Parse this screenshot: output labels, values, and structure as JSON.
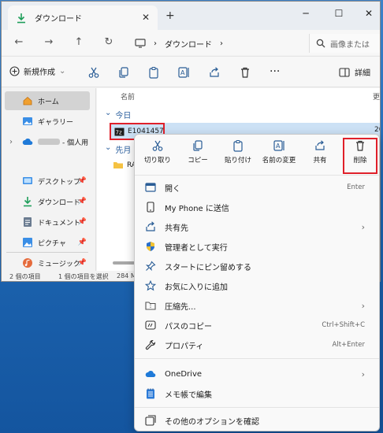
{
  "window": {
    "tab_title": "ダウンロード",
    "tab_close": "✕",
    "new_tab": "+",
    "controls": {
      "minimize": "─",
      "maximize": "☐",
      "close": "✕"
    }
  },
  "navbar": {
    "back": "←",
    "forward": "→",
    "up": "↑",
    "refresh": "↻",
    "breadcrumb_sep": "›",
    "breadcrumb_current": "ダウンロード",
    "search_placeholder": "画像または"
  },
  "toolbar": {
    "new_label": "新規作成",
    "new_caret": "⌄",
    "more": "···",
    "details_label": "詳細"
  },
  "sidebar": {
    "items": [
      {
        "label": "ホーム"
      },
      {
        "label": "ギャラリー"
      },
      {
        "label": "- 個人用",
        "expander": "›"
      },
      {
        "label": "デスクトップ"
      },
      {
        "label": "ダウンロード"
      },
      {
        "label": "ドキュメント"
      },
      {
        "label": "ピクチャ"
      },
      {
        "label": "ミュージック"
      }
    ],
    "pin": "📌"
  },
  "content": {
    "column_name": "名前",
    "column_more": "更",
    "group_today": "今日",
    "group_last_month": "先月",
    "group_caret": "⌄",
    "file_name": "E1041457",
    "file_date": "20",
    "folder_name": "RA"
  },
  "statusbar": {
    "count": "2 個の項目",
    "selected": "1 個の項目を選択",
    "size": "284 M"
  },
  "context_menu": {
    "quick_actions": [
      {
        "label": "切り取り"
      },
      {
        "label": "コピー"
      },
      {
        "label": "貼り付け"
      },
      {
        "label": "名前の変更"
      },
      {
        "label": "共有"
      },
      {
        "label": "削除"
      }
    ],
    "items": [
      {
        "label": "開く",
        "shortcut": "Enter"
      },
      {
        "label": "My Phone に送信"
      },
      {
        "label": "共有先",
        "arrow": "›"
      },
      {
        "label": "管理者として実行"
      },
      {
        "label": "スタートにピン留めする"
      },
      {
        "label": "お気に入りに追加"
      },
      {
        "label": "圧縮先...",
        "arrow": "›"
      },
      {
        "label": "パスのコピー",
        "shortcut": "Ctrl+Shift+C"
      },
      {
        "label": "プロパティ",
        "shortcut": "Alt+Enter"
      },
      {
        "label": "OneDrive",
        "arrow": "›"
      },
      {
        "label": "メモ帳で編集"
      },
      {
        "label": "その他のオプションを確認"
      }
    ]
  },
  "colors": {
    "accent": "#0067c0",
    "highlight_red": "#e0202a",
    "selection": "#cce1f5",
    "desktop": "#1e67b3"
  }
}
